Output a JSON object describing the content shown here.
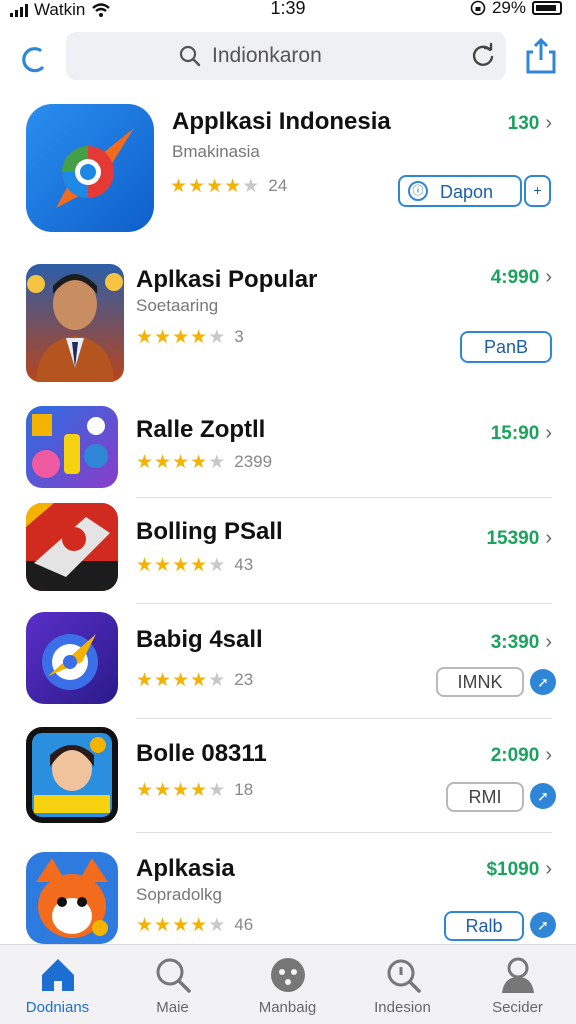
{
  "status_bar": {
    "carrier": "Watkin",
    "time": "1:39",
    "battery": "29%"
  },
  "search": {
    "query": "Indionkaron"
  },
  "apps": [
    {
      "title": "Applkasi Indonesia",
      "subtitle": "Bmakinasia",
      "rating_count": "24",
      "price": "130",
      "button_label": "Dapon",
      "stars": 4.5
    },
    {
      "title": "Aplkasi Popular",
      "subtitle": "Soetaaring",
      "rating_count": "3",
      "price": "4:990",
      "button_label": "PanB",
      "stars": 4.5
    },
    {
      "title": "Ralle Zoptll",
      "subtitle": "",
      "rating_count": "2399",
      "price": "15:90",
      "button_label": "",
      "stars": 4.5
    },
    {
      "title": "Bolling PSall",
      "subtitle": "",
      "rating_count": "43",
      "price": "15390",
      "button_label": "",
      "stars": 4.5
    },
    {
      "title": "Babig 4sall",
      "subtitle": "",
      "rating_count": "23",
      "price": "3:390",
      "button_label": "IMNK",
      "stars": 4.5
    },
    {
      "title": "Bolle 08311",
      "subtitle": "",
      "rating_count": "18",
      "price": "2:090",
      "button_label": "RMI",
      "stars": 4.5
    },
    {
      "title": "Aplkasia",
      "subtitle": "Sopradolkg",
      "rating_count": "46",
      "price": "$1090",
      "button_label": "Ralb",
      "stars": 4.5
    }
  ],
  "tabs": [
    {
      "label": "Dodnians",
      "icon": "home-icon"
    },
    {
      "label": "Maie",
      "icon": "search-icon"
    },
    {
      "label": "Manbaig",
      "icon": "face-icon"
    },
    {
      "label": "Indesion",
      "icon": "search-icon"
    },
    {
      "label": "Secider",
      "icon": "person-icon"
    }
  ],
  "colors": {
    "accent": "#2f86d6",
    "price_green": "#1aa35c",
    "star": "#f5b301"
  }
}
